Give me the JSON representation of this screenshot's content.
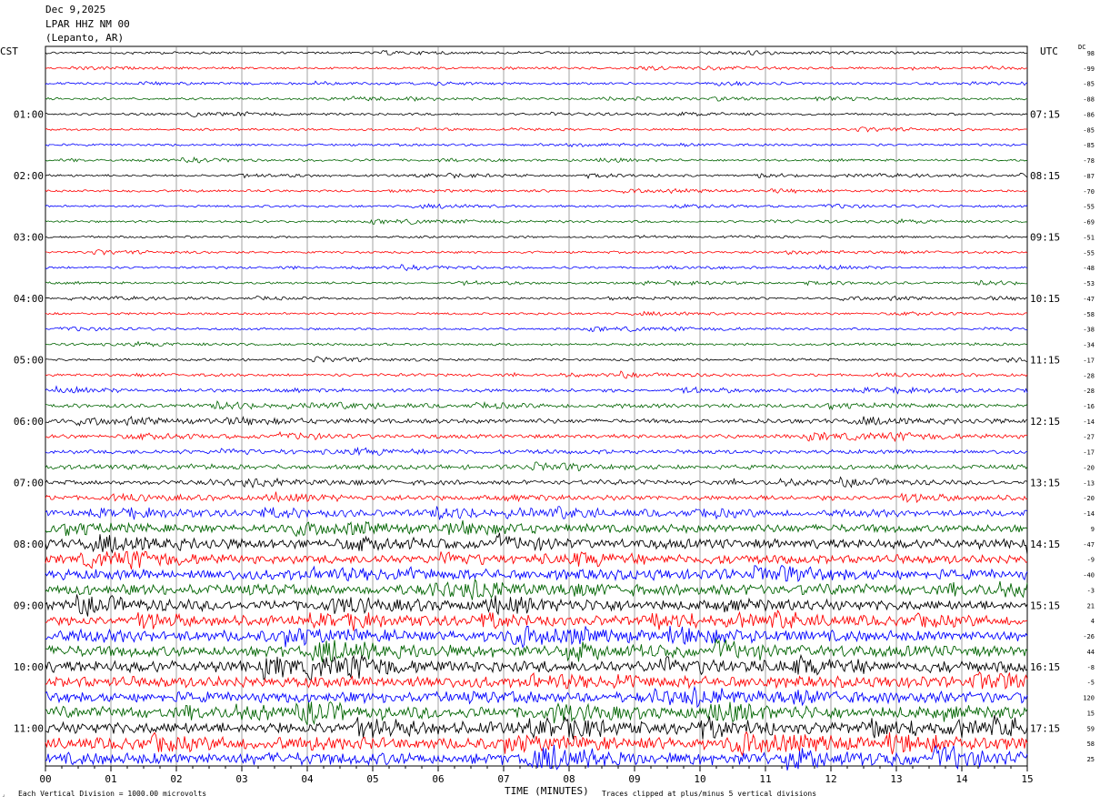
{
  "header": {
    "date": "Dec 9,2025",
    "station": "LPAR HHZ NM 00",
    "location": "(Lepanto, AR)"
  },
  "left_tz": "CST",
  "right_tz": "UTC",
  "dc_label": "DC",
  "footer": {
    "xlabel": "TIME (MINUTES)",
    "scale_note": "Each Vertical Division = 1000.00 microvolts",
    "clip_note": "Traces clipped at plus/minus 5 vertical divisions"
  },
  "chart_data": {
    "type": "line",
    "title": "LPAR HHZ NM 00",
    "xlabel": "TIME (MINUTES)",
    "xlim": [
      0,
      15
    ],
    "x_ticks": [
      "00",
      "01",
      "02",
      "03",
      "04",
      "05",
      "06",
      "07",
      "08",
      "09",
      "10",
      "11",
      "12",
      "13",
      "14",
      "15"
    ],
    "left_hour_labels": [
      "01:00",
      "02:00",
      "03:00",
      "04:00",
      "05:00",
      "06:00",
      "07:00",
      "08:00",
      "09:00",
      "10:00",
      "11:00"
    ],
    "right_hour_labels": [
      "07:15",
      "08:15",
      "09:15",
      "10:15",
      "11:15",
      "12:15",
      "13:15",
      "14:15",
      "15:15",
      "16:15",
      "17:15"
    ],
    "dc_offsets": [
      98,
      -99,
      -85,
      -88,
      -86,
      -85,
      -85,
      -78,
      -87,
      -70,
      -55,
      -69,
      -51,
      -55,
      -48,
      -53,
      -47,
      -58,
      -38,
      -34,
      -17,
      -28,
      -28,
      -16,
      -14,
      -27,
      -17,
      -20,
      -13,
      -20,
      -14,
      9,
      -47,
      -9,
      -40,
      -3,
      21,
      4,
      -26,
      44,
      -8,
      -5,
      120,
      15,
      59,
      58,
      25
    ],
    "trace_colors": [
      "#000000",
      "#ff0000",
      "#0000ff",
      "#006400"
    ],
    "trace_noise_levels": [
      1.0,
      1.0,
      1.0,
      1.0,
      1.0,
      1.0,
      1.0,
      1.0,
      1.0,
      1.0,
      1.0,
      1.0,
      1.0,
      1.0,
      1.0,
      1.0,
      1.0,
      1.0,
      1.0,
      1.1,
      1.1,
      1.2,
      1.5,
      1.7,
      2.0,
      1.8,
      1.8,
      2.0,
      2.0,
      2.2,
      2.8,
      3.6,
      4.2,
      3.8,
      4.5,
      4.6,
      4.5,
      4.0,
      4.8,
      5.0,
      5.0,
      4.8,
      4.8,
      5.0,
      5.0,
      5.2,
      5.4
    ],
    "units": "1000.00 microvolts per vertical division",
    "clip": "plus/minus 5 vertical divisions"
  }
}
